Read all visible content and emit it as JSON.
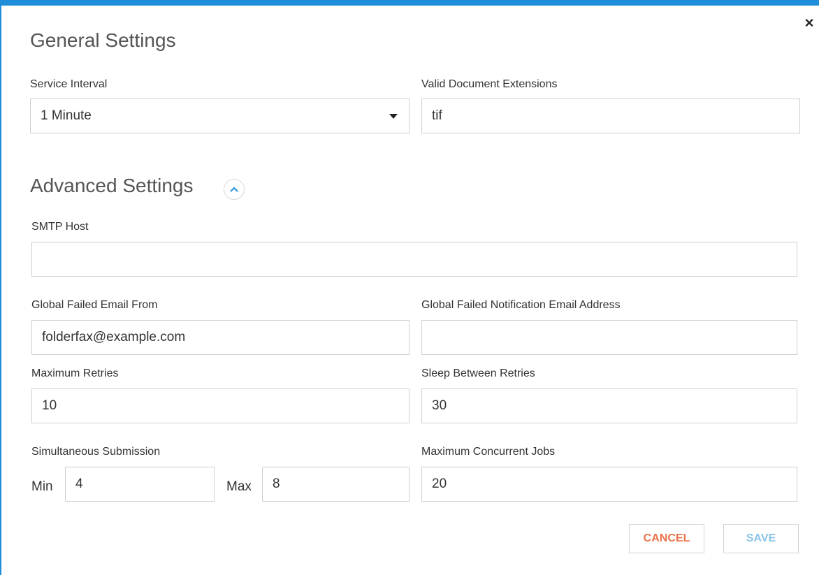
{
  "dialog": {
    "general_title": "General Settings",
    "advanced_title": "Advanced Settings"
  },
  "general": {
    "service_interval_label": "Service Interval",
    "service_interval_value": "1 Minute",
    "extensions_label": "Valid Document Extensions",
    "extensions_value": "tif"
  },
  "advanced": {
    "smtp_host_label": "SMTP Host",
    "smtp_host_value": "",
    "email_from_label": "Global Failed Email From",
    "email_from_value": "folderfax@example.com",
    "notify_email_label": "Global Failed Notification Email Address",
    "notify_email_value": "",
    "max_retries_label": "Maximum Retries",
    "max_retries_value": "10",
    "sleep_label": "Sleep Between Retries",
    "sleep_value": "30",
    "simultaneous_label": "Simultaneous Submission",
    "min_label": "Min",
    "min_value": "4",
    "max_label": "Max",
    "max_value": "8",
    "concurrent_label": "Maximum Concurrent Jobs",
    "concurrent_value": "20"
  },
  "buttons": {
    "cancel": "CANCEL",
    "save": "SAVE"
  },
  "icons": {
    "close": "close-icon",
    "collapse": "chevron-up-icon",
    "dropdown": "caret-down-icon"
  },
  "colors": {
    "accent": "#1e8ed8",
    "cancel": "#e8734a",
    "save": "#8cc4e8"
  }
}
